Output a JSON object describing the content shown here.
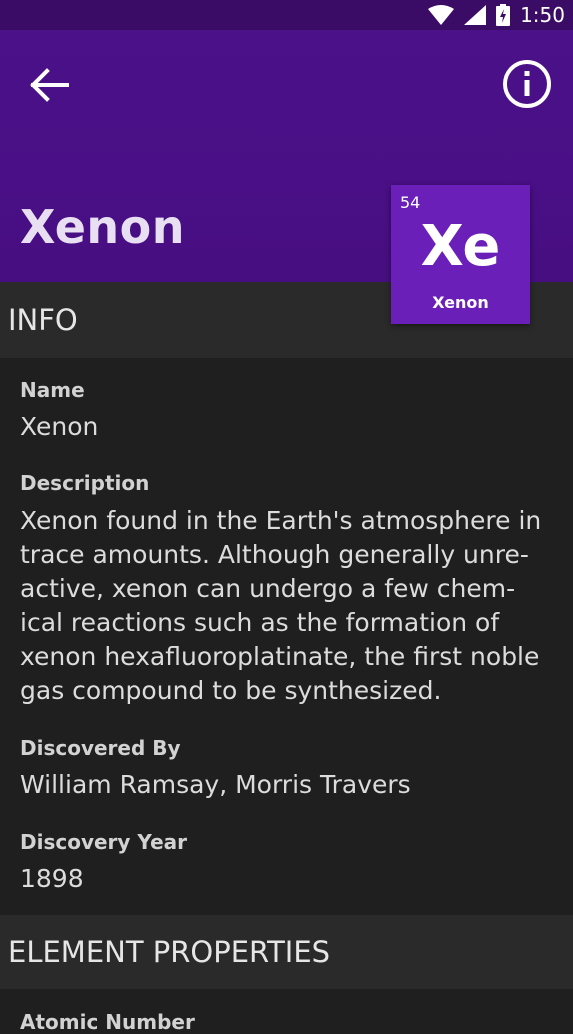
{
  "status_bar": {
    "time": "1:50",
    "icons": [
      "wifi-icon",
      "signal-icon",
      "battery-charging-icon"
    ]
  },
  "app_bar": {
    "title": "Xenon",
    "back_icon": "arrow-back-icon",
    "info_icon": "info-icon",
    "color": "#4a1188"
  },
  "element_tile": {
    "atomic_number": "54",
    "symbol": "Xe",
    "name": "Xenon",
    "color": "#6a1fb8"
  },
  "sections": {
    "info": {
      "title": "INFO"
    },
    "properties": {
      "title": "ELEMENT PROPERTIES"
    }
  },
  "info": {
    "name_label": "Name",
    "name_value": "Xenon",
    "description_label": "Description",
    "description_lines": [
      "Xenon found in the Earth's atmosphere in",
      "trace amounts. Although generally unre-",
      "active, xenon can undergo a few chem-",
      "ical reactions such as the formation of",
      "xenon hexafluoroplatinate, the first noble",
      "gas compound to be synthesized."
    ],
    "discovered_by_label": "Discovered By",
    "discovered_by_value": "William Ramsay, Morris Travers",
    "discovery_year_label": "Discovery Year",
    "discovery_year_value": "1898"
  },
  "properties": {
    "atomic_number_label": "Atomic Number"
  }
}
